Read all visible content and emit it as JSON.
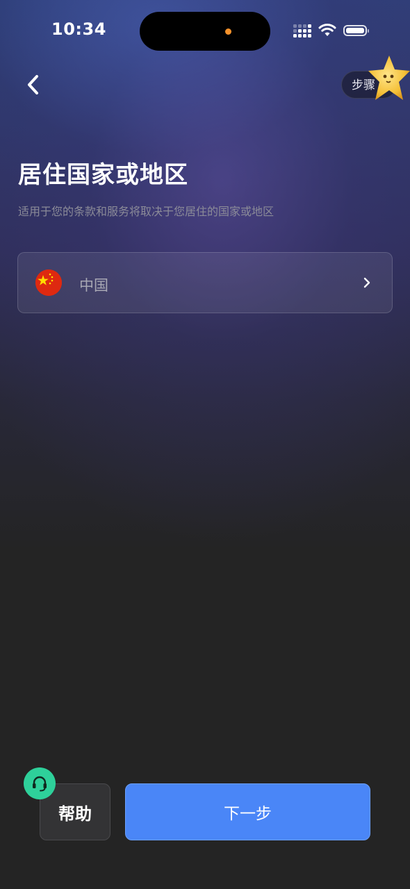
{
  "status_bar": {
    "time": "10:34",
    "icons": [
      "cellular-signal-icon",
      "wifi-icon",
      "battery-icon"
    ]
  },
  "header": {
    "back_icon": "chevron-left-icon",
    "step_label": "步骤 1"
  },
  "page": {
    "title": "居住国家或地区",
    "subtitle": "适用于您的条款和服务将取决于您居住的国家或地区"
  },
  "country_selector": {
    "flag_icon": "china-flag-icon",
    "value": "中国",
    "chevron_icon": "chevron-right-icon"
  },
  "footer": {
    "help_label": "帮助",
    "help_icon": "headset-icon",
    "next_label": "下一步"
  },
  "colors": {
    "primary_button": "#4a86f7",
    "support_badge": "#2ed09a",
    "flag_red": "#de2910",
    "flag_star": "#ffde00"
  }
}
